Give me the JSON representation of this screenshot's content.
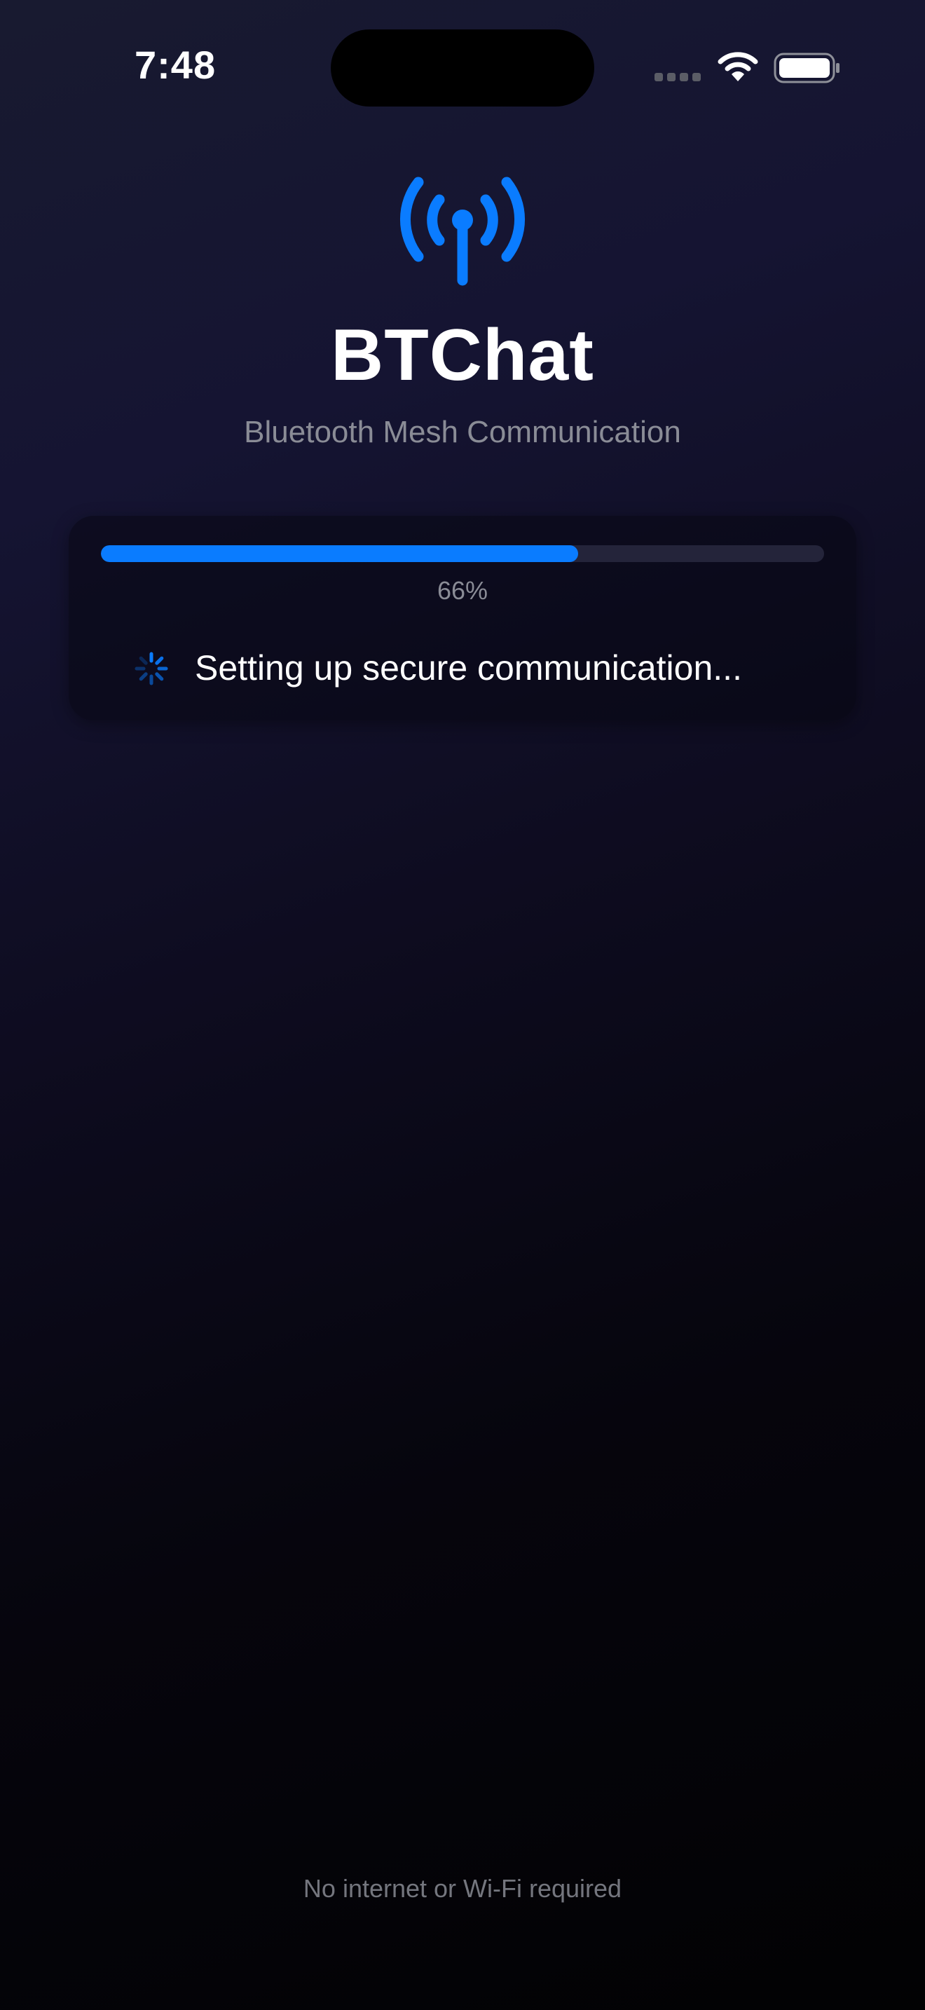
{
  "status_bar": {
    "time": "7:48",
    "icons": [
      "cellular-signal-icon",
      "wifi-icon",
      "battery-icon"
    ]
  },
  "app": {
    "logo_icon": "antenna-radiowaves-icon",
    "title": "BTChat",
    "subtitle": "Bluetooth Mesh Communication"
  },
  "progress": {
    "value": 0.66,
    "label": "66%",
    "status_icon": "activity-spinner-icon",
    "status_text": "Setting up secure communication..."
  },
  "footer": {
    "note": "No internet or Wi-Fi required"
  },
  "colors": {
    "accent": "#0a7cff",
    "track": "#24243a",
    "secondary_text": "#8a8c96"
  }
}
